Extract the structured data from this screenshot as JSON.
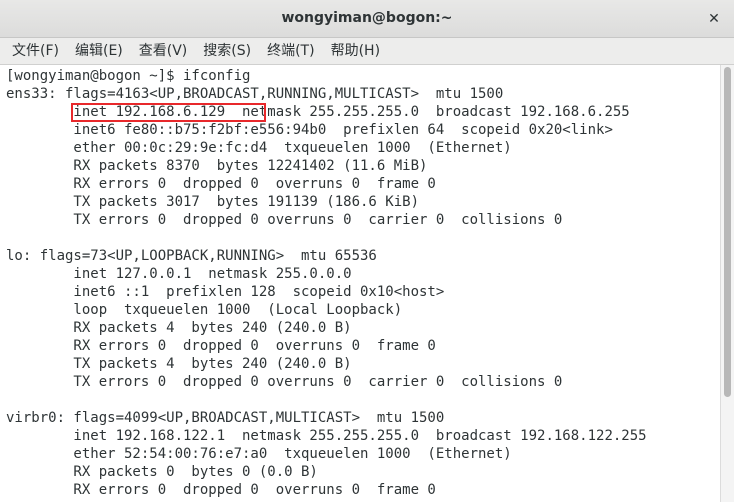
{
  "window": {
    "title": "wongyiman@bogon:~",
    "close_glyph": "✕"
  },
  "menubar": {
    "items": [
      {
        "label": "文件(F)"
      },
      {
        "label": "编辑(E)"
      },
      {
        "label": "查看(V)"
      },
      {
        "label": "搜索(S)"
      },
      {
        "label": "终端(T)"
      },
      {
        "label": "帮助(H)"
      }
    ]
  },
  "terminal": {
    "lines": [
      "[wongyiman@bogon ~]$ ifconfig",
      "ens33: flags=4163<UP,BROADCAST,RUNNING,MULTICAST>  mtu 1500",
      "        inet 192.168.6.129  netmask 255.255.255.0  broadcast 192.168.6.255",
      "        inet6 fe80::b75:f2bf:e556:94b0  prefixlen 64  scopeid 0x20<link>",
      "        ether 00:0c:29:9e:fc:d4  txqueuelen 1000  (Ethernet)",
      "        RX packets 8370  bytes 12241402 (11.6 MiB)",
      "        RX errors 0  dropped 0  overruns 0  frame 0",
      "        TX packets 3017  bytes 191139 (186.6 KiB)",
      "        TX errors 0  dropped 0 overruns 0  carrier 0  collisions 0",
      "",
      "lo: flags=73<UP,LOOPBACK,RUNNING>  mtu 65536",
      "        inet 127.0.0.1  netmask 255.0.0.0",
      "        inet6 ::1  prefixlen 128  scopeid 0x10<host>",
      "        loop  txqueuelen 1000  (Local Loopback)",
      "        RX packets 4  bytes 240 (240.0 B)",
      "        RX errors 0  dropped 0  overruns 0  frame 0",
      "        TX packets 4  bytes 240 (240.0 B)",
      "        TX errors 0  dropped 0 overruns 0  carrier 0  collisions 0",
      "",
      "virbr0: flags=4099<UP,BROADCAST,MULTICAST>  mtu 1500",
      "        inet 192.168.122.1  netmask 255.255.255.0  broadcast 192.168.122.255",
      "        ether 52:54:00:76:e7:a0  txqueuelen 1000  (Ethernet)",
      "        RX packets 0  bytes 0 (0.0 B)",
      "        RX errors 0  dropped 0  overruns 0  frame 0"
    ],
    "highlight_color": "#e8282b"
  }
}
